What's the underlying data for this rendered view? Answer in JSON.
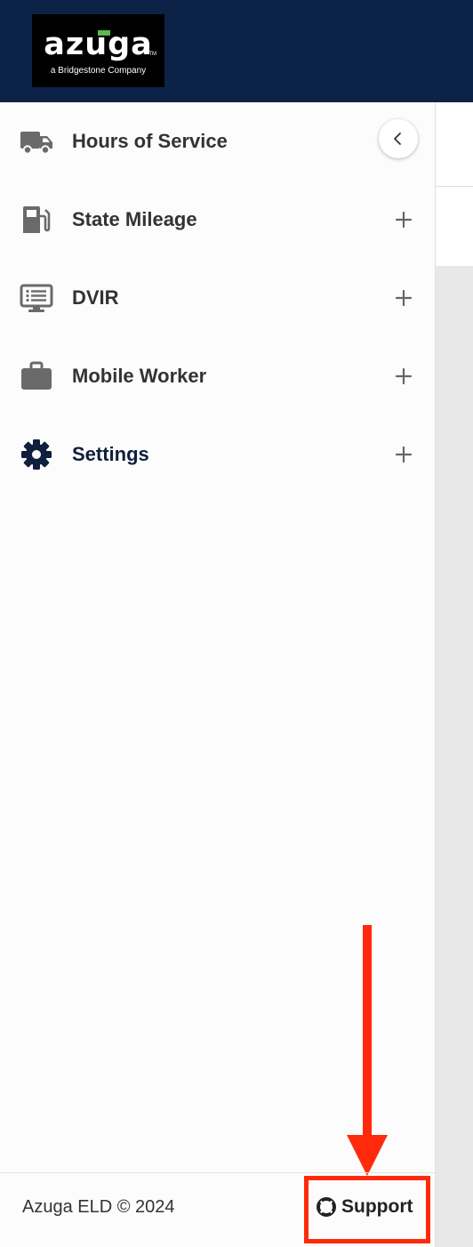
{
  "header": {
    "logo": {
      "wordmark": "azuga",
      "tagline": "a Bridgestone Company",
      "trademark": "TM"
    }
  },
  "sidebar": {
    "collapse_icon": "chevron-left-icon",
    "items": [
      {
        "label": "Hours of Service",
        "icon": "truck-icon",
        "expandable": false
      },
      {
        "label": "State Mileage",
        "icon": "fuel-pump-icon",
        "expandable": true
      },
      {
        "label": "DVIR",
        "icon": "monitor-list-icon",
        "expandable": true
      },
      {
        "label": "Mobile Worker",
        "icon": "briefcase-icon",
        "expandable": true
      },
      {
        "label": "Settings",
        "icon": "gear-icon",
        "expandable": true
      }
    ]
  },
  "footer": {
    "copyright": "Azuga ELD © 2024",
    "support_label": "Support",
    "support_icon": "lifebuoy-icon"
  },
  "annotation": {
    "color": "#ff2a0c",
    "target": "support-button"
  },
  "colors": {
    "header_bg": "#0c2247",
    "logo_accent": "#5cb947",
    "settings_text": "#0f1f3d",
    "icon_gray": "#6a6a6a"
  }
}
